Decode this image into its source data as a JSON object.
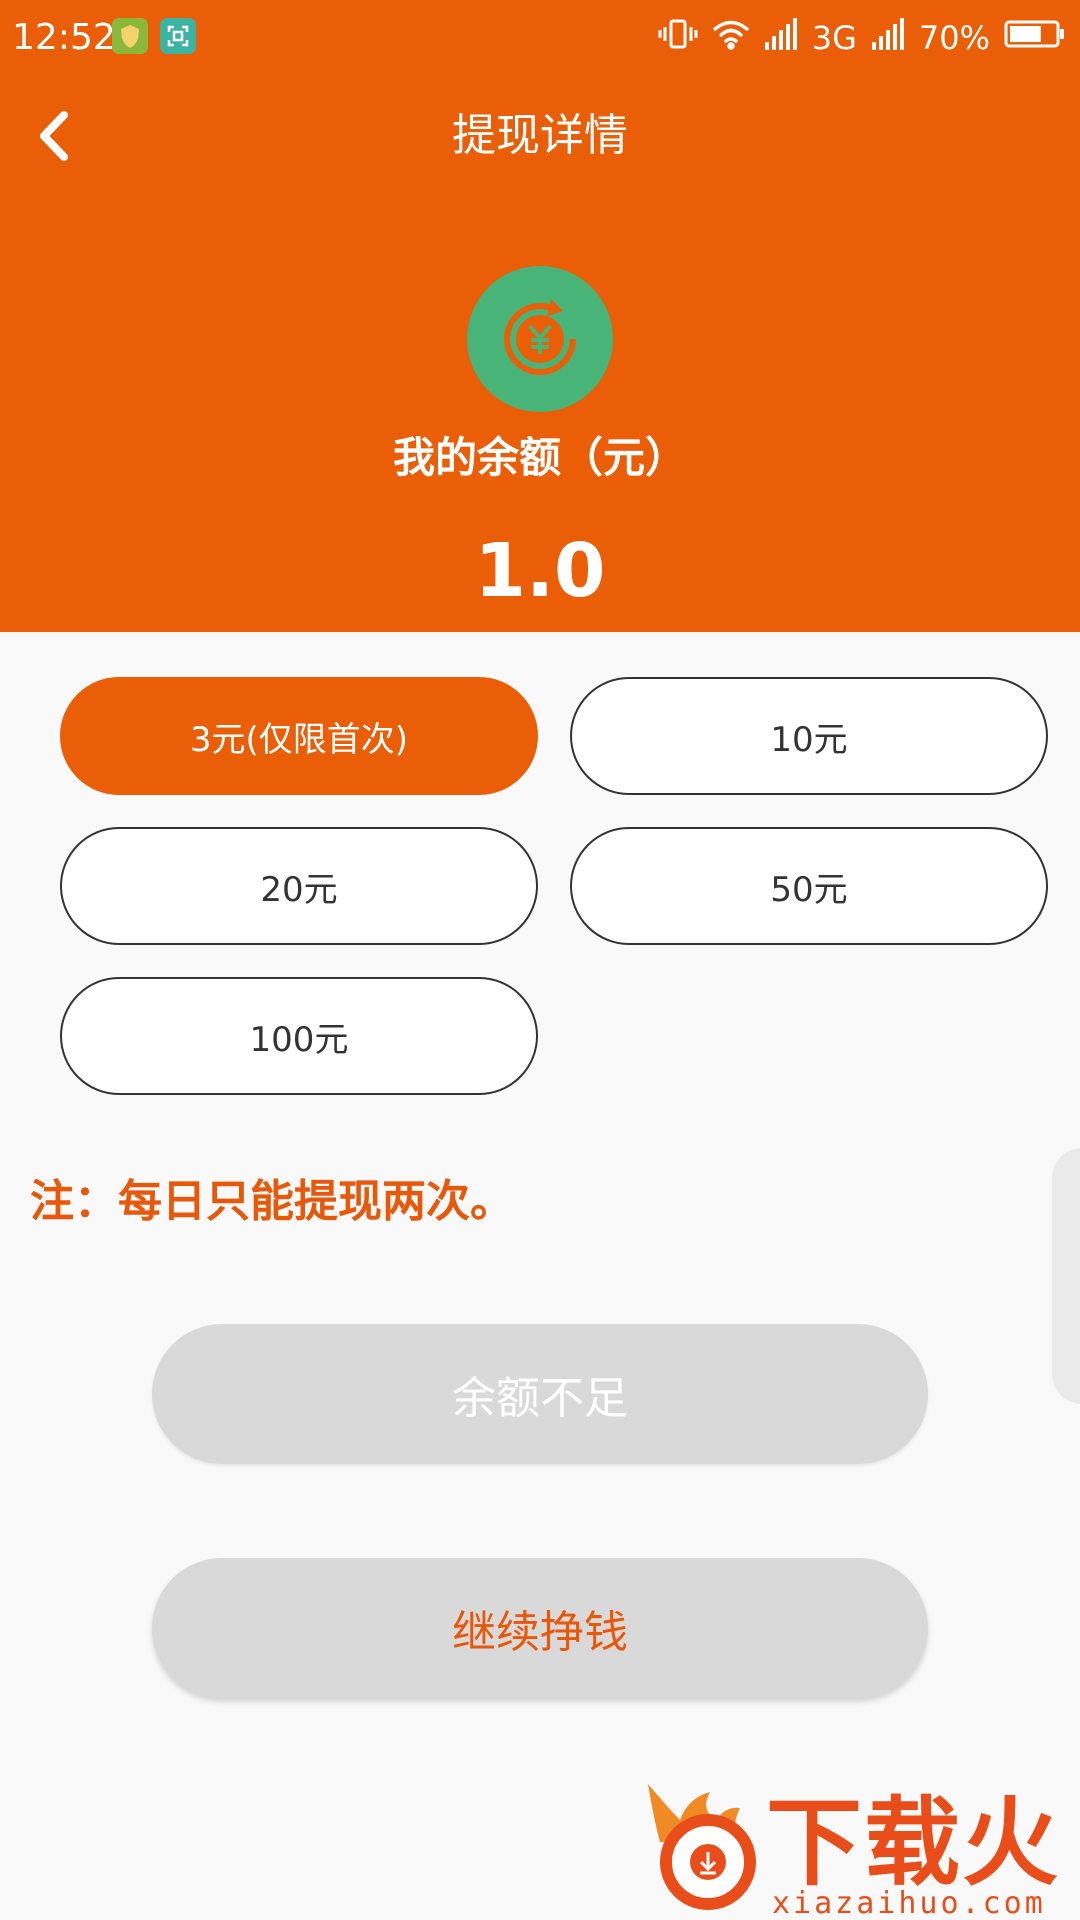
{
  "status_bar": {
    "time": "12:52",
    "network": "3G",
    "battery": "70%",
    "battery_level": 0.7,
    "icons": [
      "shield-app-icon",
      "scan-app-icon",
      "vibrate-icon",
      "wifi-icon",
      "signal-icon",
      "signal-icon",
      "battery-icon"
    ]
  },
  "nav": {
    "back_icon": "chevron-left-icon",
    "title": "提现详情"
  },
  "balance": {
    "icon": "yuan-refresh-icon",
    "label": "我的余额（元）",
    "value": "1.0"
  },
  "amount_options": [
    {
      "label": "3元(仅限首次)",
      "selected": true
    },
    {
      "label": "10元",
      "selected": false
    },
    {
      "label": "20元",
      "selected": false
    },
    {
      "label": "50元",
      "selected": false
    },
    {
      "label": "100元",
      "selected": false
    }
  ],
  "note": "注：每日只能提现两次。",
  "buttons": {
    "insufficient": "余额不足",
    "continue": "继续挣钱"
  },
  "watermark": {
    "text": "下载火",
    "domain": "xiazaihuo.com"
  },
  "colors": {
    "primary": "#ea5e08",
    "icon_green": "#48b478",
    "button_gray": "#d9d9d9",
    "note_orange": "#e8580a",
    "watermark_red": "#e94e1a"
  }
}
